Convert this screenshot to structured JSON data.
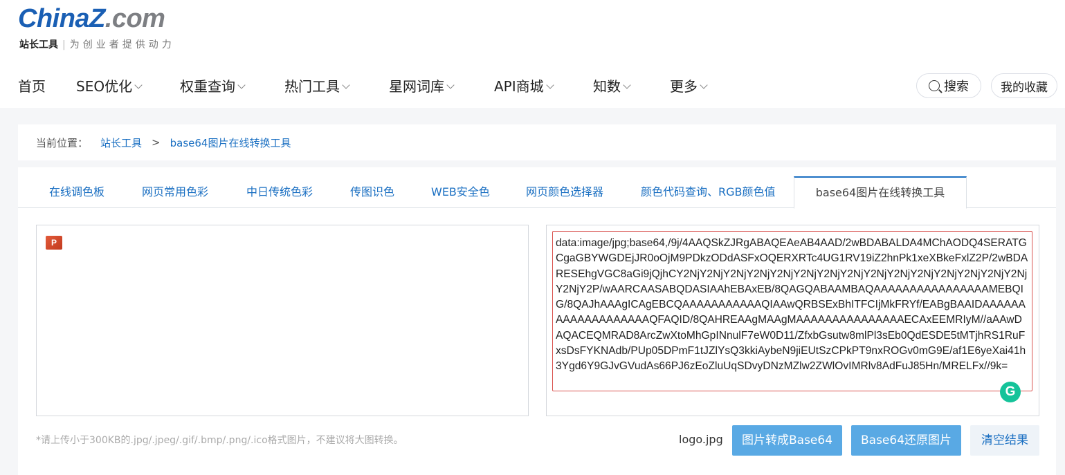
{
  "logo": {
    "brand_a": "China",
    "brand_z": "Z",
    "brand_b": ".com",
    "sub_title": "站长工具",
    "slogan": "为创业者提供动力"
  },
  "nav": {
    "items": [
      {
        "label": "首页",
        "dropdown": false
      },
      {
        "label": "SEO优化",
        "dropdown": true
      },
      {
        "label": "权重查询",
        "dropdown": true
      },
      {
        "label": "热门工具",
        "dropdown": true
      },
      {
        "label": "星网词库",
        "dropdown": true
      },
      {
        "label": "API商城",
        "dropdown": true
      },
      {
        "label": "知数",
        "dropdown": true
      },
      {
        "label": "更多",
        "dropdown": true
      }
    ],
    "search_label": "搜索",
    "favorites_label": "我的收藏"
  },
  "breadcrumb": {
    "prefix": "当前位置：",
    "home": "站长工具",
    "separator": ">",
    "current": "base64图片在线转换工具"
  },
  "tabs": [
    {
      "label": "在线调色板",
      "active": false
    },
    {
      "label": "网页常用色彩",
      "active": false
    },
    {
      "label": "中日传统色彩",
      "active": false
    },
    {
      "label": "传图识色",
      "active": false
    },
    {
      "label": "WEB安全色",
      "active": false
    },
    {
      "label": "网页颜色选择器",
      "active": false
    },
    {
      "label": "颜色代码查询、RGB颜色值",
      "active": false
    },
    {
      "label": "base64图片在线转换工具",
      "active": true
    }
  ],
  "converter": {
    "preview_icon": "powerpoint-file-icon",
    "output_text": "data:image/jpg;base64,/9j/4AAQSkZJRgABAQEAeAB4AAD/2wBDABALDA4MChAODQ4SERATGCgaGBYWGDEjJR0oOjM9PDkzODdASFxOQERXRTc4UG1RV19iZ2hnPk1xeXBkeFxlZ2P/2wBDARESEhgVGC8aGi9jQjhCY2NjY2NjY2NjY2NjY2NjY2NjY2NjY2NjY2NjY2NjY2NjY2NjY2NjY2NjY2NjY2NjY2P/wAARCAASABQDASIAAhEBAxEB/8QAGQABAAMBAQAAAAAAAAAAAAAAAAMEBQIG/8QAJhAAAgICAgEBCQAAAAAAAAAAAQIAAwQRBSExBhITFCIjMkFRYf/EABgBAAIDAAAAAAAAAAAAAAAAAAAQFAQID/8QAHREAAgMAAgMAAAAAAAAAAAAAAAECAxEEMRIyM//aAAwDAQACEQMRAD8ArcZwXtoMhGpINnulF7eW0D11/ZfxbGsutw8mlPl3sEb0QdESDE5tMTjhRS1RuFxsDsFYKNAdb/PUp05DPmF1tJZlYsQ3kkiAybeN9jiEUtSzCPkPT9nxROGv0mG9E/af1E6yeXai41h3Ygd6Y9GJvGVudAs66PJ6zEoZluUqSDvyDNzMZlw2ZWlOvIMRlv8AdFuJ85Hn/MRELFx//9k=",
    "hint": "*请上传小于300KB的.jpg/.jpeg/.gif/.bmp/.png/.ico格式图片，不建议将大图转换。",
    "filename": "logo.jpg",
    "to_base64_label": "图片转成Base64",
    "to_image_label": "Base64还原图片",
    "clear_label": "清空结果",
    "grammarly_icon": "grammarly-icon"
  },
  "colors": {
    "link_blue": "#1a6fc2",
    "button_blue": "#59a9e4",
    "error_border": "#d9534f",
    "grammarly_green": "#15c39a"
  }
}
